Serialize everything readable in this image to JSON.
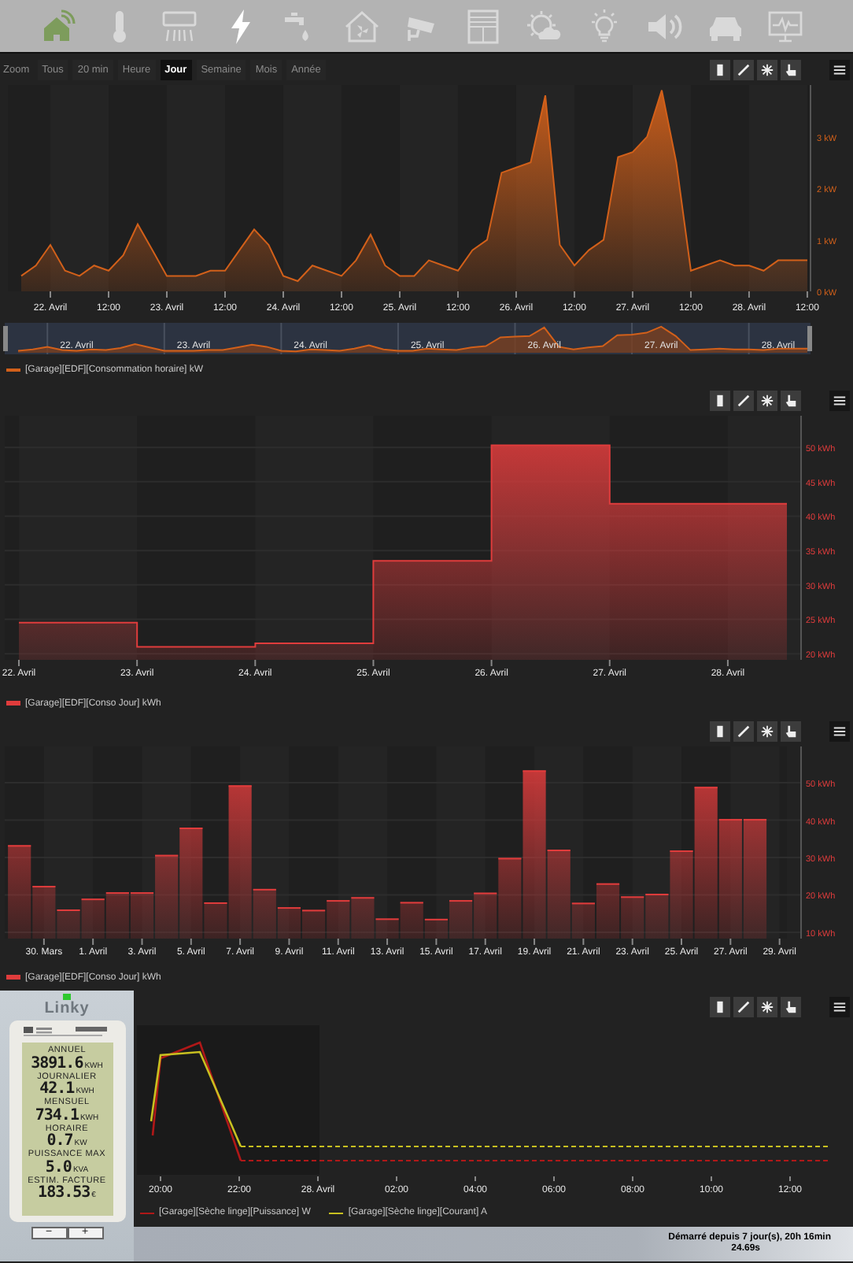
{
  "nav": {
    "items": [
      {
        "kind": "home",
        "selected": false
      },
      {
        "kind": "thermometer",
        "selected": false
      },
      {
        "kind": "air-conditioner",
        "selected": false
      },
      {
        "kind": "lightning",
        "selected": true
      },
      {
        "kind": "tap",
        "selected": false
      },
      {
        "kind": "house-fan",
        "selected": false
      },
      {
        "kind": "camera",
        "selected": false
      },
      {
        "kind": "shutter",
        "selected": false
      },
      {
        "kind": "weather",
        "selected": false
      },
      {
        "kind": "bulb",
        "selected": false
      },
      {
        "kind": "speaker",
        "selected": false
      },
      {
        "kind": "car",
        "selected": false
      },
      {
        "kind": "monitor",
        "selected": false
      }
    ]
  },
  "panels": [
    {
      "range_selector": {
        "label": "Zoom",
        "buttons": [
          {
            "label": "Tous",
            "selected": false
          },
          {
            "label": "20 min",
            "selected": false
          },
          {
            "label": "Heure",
            "selected": false
          },
          {
            "label": "Jour",
            "selected": true
          },
          {
            "label": "Semaine",
            "selected": false
          },
          {
            "label": "Mois",
            "selected": false
          },
          {
            "label": "Année",
            "selected": false
          }
        ]
      },
      "chart_data": {
        "type": "area",
        "grid": false,
        "ylim": [
          0,
          4
        ],
        "categories": [
          null,
          null,
          "22. Avril",
          null,
          null,
          null,
          "12:00",
          null,
          null,
          null,
          "23. Avril",
          null,
          null,
          null,
          "12:00",
          null,
          null,
          null,
          "24. Avril",
          null,
          null,
          null,
          "12:00",
          null,
          null,
          null,
          "25. Avril",
          null,
          null,
          null,
          "12:00",
          null,
          null,
          null,
          "26. Avril",
          null,
          null,
          null,
          "12:00",
          null,
          null,
          null,
          "27. Avril",
          null,
          null,
          null,
          "12:00",
          null,
          null,
          null,
          "28. Avril",
          null,
          null,
          null,
          "12:00"
        ],
        "series": [
          {
            "name": "[Garage][EDF][Consommation horaire] kW",
            "color": "#d2601a",
            "values": [
              0.3,
              0.5,
              0.9,
              0.4,
              0.3,
              0.5,
              0.4,
              0.7,
              1.3,
              0.8,
              0.3,
              0.3,
              0.3,
              0.4,
              0.4,
              0.8,
              1.2,
              0.9,
              0.3,
              0.2,
              0.5,
              0.4,
              0.3,
              0.6,
              1.1,
              0.5,
              0.3,
              0.3,
              0.6,
              0.5,
              0.4,
              0.8,
              1.0,
              2.3,
              2.4,
              2.5,
              3.8,
              0.9,
              0.5,
              0.8,
              1.0,
              2.6,
              2.7,
              3.0,
              3.9,
              2.5,
              0.4,
              0.5,
              0.6,
              0.5,
              0.5,
              0.4,
              0.6,
              0.6,
              0.6
            ]
          }
        ],
        "yticks": [
          {
            "value": 0,
            "label": "0 kW"
          },
          {
            "value": 1,
            "label": "1 kW"
          },
          {
            "value": 2,
            "label": "2 kW"
          },
          {
            "value": 3,
            "label": "3 kW"
          }
        ]
      },
      "navigator": {
        "labels": [
          "22. Avril",
          "23. Avril",
          "24. Avril",
          "25. Avril",
          "26. Avril",
          "27. Avril",
          "28. Avril"
        ]
      }
    },
    {
      "chart_data": {
        "type": "area",
        "grid": true,
        "xlim": [
          21.88,
          28.62
        ],
        "ylim": [
          19.1,
          54.6
        ],
        "x": [
          22,
          23,
          23,
          24,
          24,
          25,
          25,
          26,
          26,
          27,
          27,
          28.5
        ],
        "series": [
          {
            "name": "[Garage][EDF][Conso Jour] kWh",
            "color": "#e03c3c",
            "values": [
              24.5,
              24.5,
              21,
              21,
              21.5,
              21.5,
              33.5,
              33.5,
              50.3,
              50.3,
              41.8,
              41.8
            ]
          }
        ],
        "xticks": [
          {
            "value": 22,
            "label": "22. Avril"
          },
          {
            "value": 23,
            "label": "23. Avril"
          },
          {
            "value": 24,
            "label": "24. Avril"
          },
          {
            "value": 25,
            "label": "25. Avril"
          },
          {
            "value": 26,
            "label": "26. Avril"
          },
          {
            "value": 27,
            "label": "27. Avril"
          },
          {
            "value": 28,
            "label": "28. Avril"
          }
        ],
        "yticks": [
          {
            "value": 20,
            "label": "20 kWh"
          },
          {
            "value": 25,
            "label": "25 kWh"
          },
          {
            "value": 30,
            "label": "30 kWh"
          },
          {
            "value": 35,
            "label": "35 kWh"
          },
          {
            "value": 40,
            "label": "40 kWh"
          },
          {
            "value": 45,
            "label": "45 kWh"
          },
          {
            "value": 50,
            "label": "50 kWh"
          }
        ]
      }
    },
    {
      "chart_data": {
        "type": "bar",
        "grid": true,
        "ylim": [
          8.3,
          59.7
        ],
        "categories": [
          null,
          "30. Mars",
          null,
          "1. Avril",
          null,
          "3. Avril",
          null,
          "5. Avril",
          null,
          "7. Avril",
          null,
          "9. Avril",
          null,
          "11. Avril",
          null,
          "13. Avril",
          null,
          "15. Avril",
          null,
          "17. Avril",
          null,
          "19. Avril",
          null,
          "21. Avril",
          null,
          "23. Avril",
          null,
          "25. Avril",
          null,
          "27. Avril",
          null,
          "29. Avril"
        ],
        "series": [
          {
            "name": "[Garage][EDF][Conso Jour] kWh",
            "color": "#e03c3c",
            "values": [
              33.3,
              22.4,
              16.1,
              19,
              20.7,
              20.7,
              30.7,
              38,
              18,
              49.3,
              21.6,
              16.7,
              16,
              18.6,
              19.4,
              13.7,
              18.1,
              13.6,
              18.6,
              20.6,
              29.9,
              53.3,
              32.1,
              17.9,
              23.1,
              19.6,
              20.3,
              31.9,
              48.9,
              40.3,
              40.3,
              null
            ]
          }
        ],
        "yticks": [
          {
            "value": 10,
            "label": "10 kWh"
          },
          {
            "value": 20,
            "label": "20 kWh"
          },
          {
            "value": 30,
            "label": "30 kWh"
          },
          {
            "value": 40,
            "label": "40 kWh"
          },
          {
            "value": 50,
            "label": "50 kWh"
          }
        ]
      }
    }
  ],
  "linky": {
    "led_on": true,
    "title": "Linky",
    "readings": [
      {
        "label": "ANNUEL",
        "value": "3891.6",
        "unit": "KWH"
      },
      {
        "label": "JOURNALIER",
        "value": "42.1",
        "unit": "KWH"
      },
      {
        "label": "MENSUEL",
        "value": "734.1",
        "unit": "KWH"
      },
      {
        "label": "HORAIRE",
        "value": "0.7",
        "unit": "KW"
      },
      {
        "label": "PUISSANCE MAX",
        "value": "5.0",
        "unit": "KVA"
      },
      {
        "label": "ESTIM. FACTURE",
        "value": "183.53",
        "unit": "€"
      }
    ],
    "buttons": [
      "−",
      "+"
    ]
  },
  "power_chart": {
    "x_labels": [
      "20:00",
      "22:00",
      "28. Avril",
      "02:00",
      "04:00",
      "06:00",
      "08:00",
      "10:00",
      "12:00"
    ],
    "legend": [
      {
        "label": "[Garage][Sèche linge][Puissance] W",
        "color": "#b01818"
      },
      {
        "label": "[Garage][Sèche linge][Courant] A",
        "color": "#c8c020"
      }
    ]
  },
  "status": {
    "lines": [
      "Démarré depuis 7 jour(s), 20h 16min",
      "24.69s"
    ]
  }
}
